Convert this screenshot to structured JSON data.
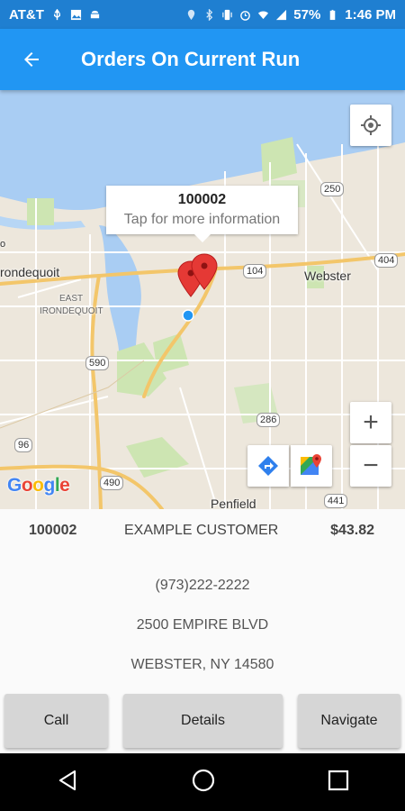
{
  "status_bar": {
    "carrier": "AT&T",
    "battery": "57%",
    "time": "1:46 PM"
  },
  "app_bar": {
    "title": "Orders On Current Run",
    "back_icon": "arrow-back-icon"
  },
  "map": {
    "info_window": {
      "title": "100002",
      "subtitle": "Tap for more information"
    },
    "labels": {
      "irondequoit": "rondequoit",
      "east_irondequoit_1": "EAST",
      "east_irondequoit_2": "IRONDEQUOIT",
      "webster": "Webster",
      "penfield": "Penfield",
      "ondequoit_top": "o"
    },
    "shields": {
      "r250": "250",
      "r104": "104",
      "r404": "404",
      "r590": "590",
      "r286": "286",
      "r96": "96",
      "r490": "490",
      "r441": "441"
    },
    "google_logo": "Google",
    "controls": {
      "zoom_in": "+",
      "zoom_out": "−"
    },
    "colors": {
      "water": "#a9cdf3",
      "land": "#ede7dc",
      "park": "#cde5b2",
      "highway": "#f3c66a",
      "marker": "#e53935",
      "location_dot": "#2196f3"
    }
  },
  "order": {
    "id": "100002",
    "customer": "EXAMPLE CUSTOMER",
    "amount": "$43.82",
    "phone": "(973)222-2222",
    "address_line1": "2500 EMPIRE BLVD",
    "address_line2": "WEBSTER, NY 14580"
  },
  "actions": {
    "call": "Call",
    "details": "Details",
    "navigate": "Navigate"
  },
  "nav_bar": {
    "back": "back-triangle-icon",
    "home": "home-circle-icon",
    "recents": "recents-square-icon"
  }
}
